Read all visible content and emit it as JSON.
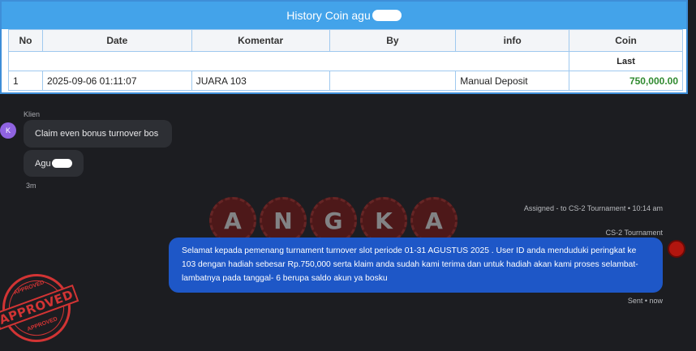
{
  "history": {
    "title": "History Coin agu",
    "columns": [
      "No",
      "Date",
      "Komentar",
      "By",
      "info",
      "Coin"
    ],
    "last_label": "Last",
    "rows": [
      {
        "no": "1",
        "date": "2025-09-06 01:11:07",
        "komentar": "JUARA 103",
        "by": "",
        "info": "Manual Deposit",
        "coin": "750,000.00"
      }
    ]
  },
  "chat": {
    "sender_label": "Klien",
    "avatar_letter": "K",
    "messages_in": [
      "Claim even bonus turnover bos",
      "Agu"
    ],
    "time_in": "3m",
    "assigned": "Assigned - to CS-2 Tournament • 10:14 am",
    "agent_name": "CS-2 Tournament",
    "message_out": "Selamat kepada pemenang turnament turnover slot periode 01-31 AGUSTUS 2025 . User ID anda menduduki peringkat ke 103 dengan hadiah sebesar Rp.750,000 serta klaim anda sudah kami terima dan untuk hadiah akan kami proses selambat-lambatnya pada tanggal- 6 berupa saldo akun ya bosku",
    "sent_status": "Sent • now"
  },
  "watermark": [
    "A",
    "N",
    "G",
    "K",
    "A"
  ],
  "stamp": {
    "main": "APPROVED",
    "top": "APPROVED",
    "bottom": "APPROVED"
  },
  "colors": {
    "header_blue": "#43a3ea",
    "bubble_blue": "#1e57c7",
    "coin_green": "#2f8a2f",
    "stamp_red": "#d23434"
  }
}
